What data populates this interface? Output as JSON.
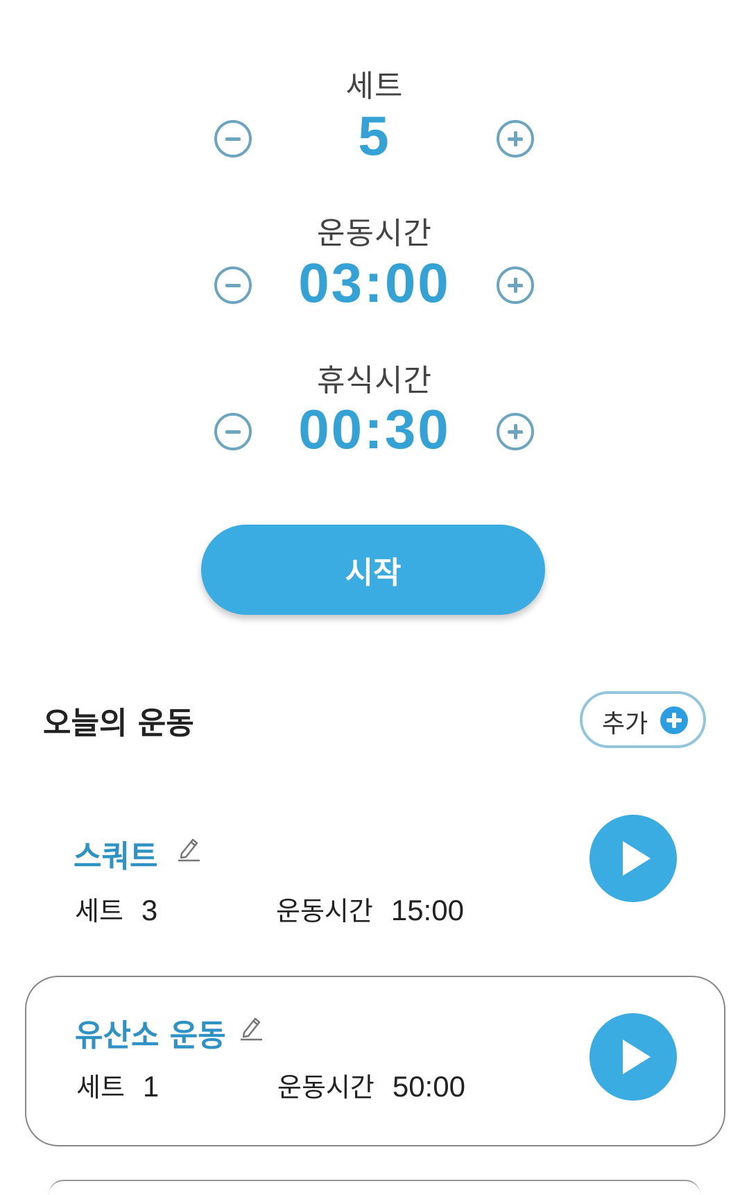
{
  "settings": {
    "sets": {
      "label": "세트",
      "value": "5"
    },
    "exercise_time": {
      "label": "운동시간",
      "value": "03:00"
    },
    "rest_time": {
      "label": "휴식시간",
      "value": "00:30"
    }
  },
  "start_button": {
    "label": "시작"
  },
  "today": {
    "title": "오늘의 운동",
    "add_button": {
      "label": "추가"
    },
    "items": [
      {
        "name": "스쿼트",
        "sets_label": "세트",
        "sets": "3",
        "time_label": "운동시간",
        "time": "15:00"
      },
      {
        "name": "유산소 운동",
        "sets_label": "세트",
        "sets": "1",
        "time_label": "운동시간",
        "time": "50:00"
      }
    ]
  },
  "icons": {
    "decrement": "minus-circle-icon",
    "increment": "plus-circle-icon",
    "edit": "pencil-icon",
    "play": "play-icon",
    "add": "plus-icon"
  },
  "colors": {
    "accent": "#3aace2",
    "value_text": "#35a2d6",
    "stepper_outline": "#6ba5c0",
    "item_name": "#2e92c4"
  }
}
